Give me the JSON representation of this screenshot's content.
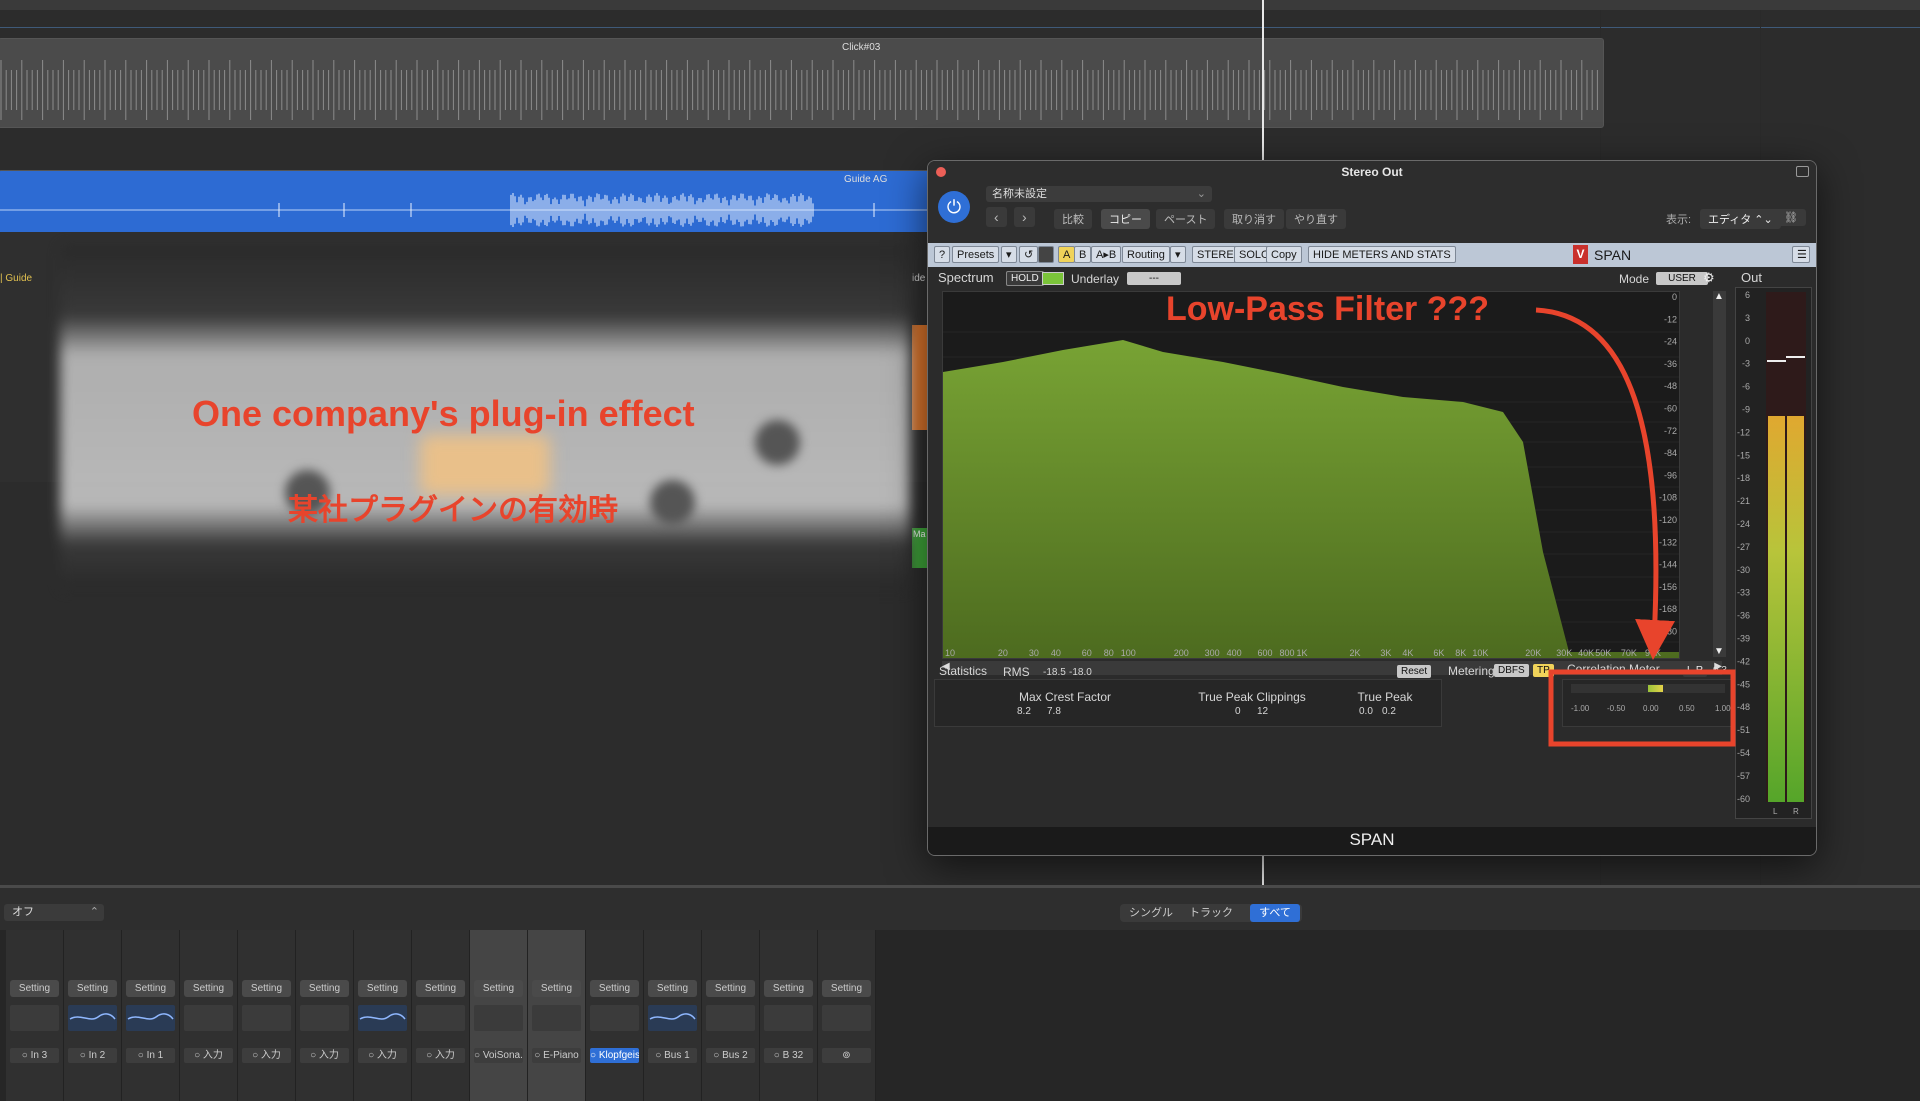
{
  "arrange": {
    "region_click": "Click#03",
    "region_guide": "Guide AG",
    "track_label_guide": "| Guide",
    "edge_label_ide": "ide",
    "edge_label_ma": "Ma"
  },
  "annotations": {
    "plugin_effect": "One company's plug-in effect",
    "plugin_effect_ja": "某社プラグインの有効時",
    "low_pass": "Low-Pass Filter ???"
  },
  "plugin": {
    "window_title": "Stereo Out",
    "preset_name": "名称未設定",
    "nav_prev": "‹",
    "nav_next": "›",
    "compare": "比較",
    "copy": "コピー",
    "paste": "ペースト",
    "undo": "取り消す",
    "redo": "やり直す",
    "view_label": "表示:",
    "view_value": "エディタ",
    "footer": "SPAN",
    "brand": "SPAN",
    "toolbar": {
      "help": "?",
      "presets": "Presets",
      "a": "A",
      "b": "B",
      "ab": "A▸B",
      "routing": "Routing",
      "stereo": "STEREO",
      "solo": "SOLO",
      "copy": "Copy",
      "hide": "HIDE METERS AND STATS"
    },
    "spectrum": {
      "label": "Spectrum",
      "hold": "HOLD",
      "underlay": "Underlay",
      "underlay_value": "---",
      "mode_label": "Mode",
      "mode_value": "USER",
      "db_ticks": [
        "0",
        "-12",
        "-24",
        "-36",
        "-48",
        "-60",
        "-72",
        "-84",
        "-96",
        "-108",
        "-120",
        "-132",
        "-144",
        "-156",
        "-168",
        "-180"
      ],
      "freq_ticks": [
        "10",
        "20",
        "30",
        "40",
        "60",
        "80",
        "100",
        "200",
        "300",
        "400",
        "600",
        "800",
        "1K",
        "2K",
        "3K",
        "4K",
        "6K",
        "8K",
        "10K",
        "20K",
        "30K",
        "40K",
        "50K",
        "70K",
        "96K"
      ]
    },
    "out": {
      "label": "Out",
      "ticks": [
        "6",
        "3",
        "0",
        "-3",
        "-6",
        "-9",
        "-12",
        "-15",
        "-18",
        "-21",
        "-24",
        "-27",
        "-30",
        "-33",
        "-36",
        "-39",
        "-42",
        "-45",
        "-48",
        "-51",
        "-54",
        "-57",
        "-60"
      ],
      "ch_l": "L",
      "ch_r": "R"
    },
    "stats": {
      "label": "Statistics",
      "rms_label": "RMS",
      "rms_l": "-18.5",
      "rms_r": "-18.0",
      "reset": "Reset",
      "metering_label": "Metering",
      "metering_value": "DBFS",
      "tp": "TP",
      "max_crest_label": "Max Crest Factor",
      "max_crest_l": "8.2",
      "max_crest_r": "7.8",
      "clip_label": "True Peak Clippings",
      "clip_l": "0",
      "clip_r": "12",
      "true_peak_label": "True Peak",
      "true_peak_l": "0.0",
      "true_peak_r": "0.2"
    },
    "correlation": {
      "label": "Correlation Meter",
      "mode": "L-R",
      "value": "0.3",
      "scale": [
        "-1.00",
        "-0.50",
        "0.00",
        "0.50",
        "1.00"
      ],
      "level": 0.6
    }
  },
  "mixer": {
    "dropdown_value": "オフ",
    "view_tabs": [
      "シングル",
      "トラック",
      "すべて"
    ],
    "setting_label": "Setting",
    "channels": [
      {
        "io": "In 3",
        "eq": false,
        "hl": false
      },
      {
        "io": "In 2",
        "eq": true,
        "hl": false
      },
      {
        "io": "In 1",
        "eq": true,
        "hl": false
      },
      {
        "io": "入力",
        "eq": false,
        "hl": false
      },
      {
        "io": "入力",
        "eq": false,
        "hl": false
      },
      {
        "io": "入力",
        "eq": false,
        "hl": false
      },
      {
        "io": "入力",
        "eq": true,
        "hl": false
      },
      {
        "io": "入力",
        "eq": false,
        "hl": false
      },
      {
        "io": "VoiSona...",
        "eq": false,
        "hl": true
      },
      {
        "io": "E-Piano",
        "eq": false,
        "hl": true
      },
      {
        "io": "Klopfgeist",
        "eq": false,
        "hl": false
      },
      {
        "io": "Bus 1",
        "eq": true,
        "hl": false
      },
      {
        "io": "Bus 2",
        "eq": false,
        "hl": false
      },
      {
        "io": "B 32",
        "eq": false,
        "hl": false
      },
      {
        "io": "",
        "eq": false,
        "hl": false
      }
    ]
  },
  "colors": {
    "spectrum_fill": "#6f9a2c",
    "annotation_red": "#e8442c",
    "accent_blue": "#2f6fd6"
  }
}
